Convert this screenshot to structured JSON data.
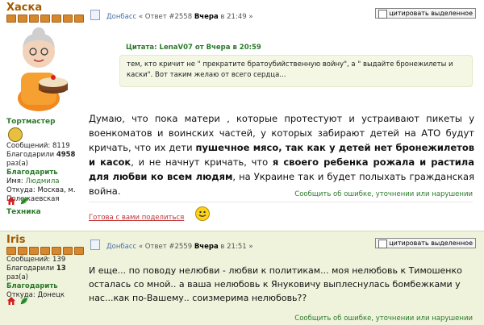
{
  "post1": {
    "user": {
      "name": "Хаска",
      "rank": "Тортмастер",
      "stats": {
        "messages_label": "Сообщений:",
        "messages": "8119",
        "thanked_label": "Благодарили",
        "thanked": "4958",
        "thanked_suffix": "раз(а)"
      },
      "thank_link": "Благодарить",
      "name_label": "Имя:",
      "real_name": "Людмила",
      "from_label": "Откуда:",
      "location": "Москва, м. Полежаевская",
      "section": "Техника"
    },
    "header": {
      "forum": "Донбасс",
      "reply_prefix": "« Ответ #2558",
      "date": "Вчера",
      "time_prefix": "в 21:49 »"
    },
    "quote_button": "цитировать выделенное",
    "quote": {
      "title": "Цитата: LenaV07 от Вчера в 20:59",
      "text": "тем, кто кричит не \" прекратите братоубийственную войну\", а \" выдайте бронежилеты и каски\". Вот таким желаю от всего сердца..."
    },
    "body": {
      "p1": "Думаю, что пока матери , которые протестуют и устраивают пикеты у военкоматов и воинских частей, у которых забирают детей на АТО будут кричать, что их дети ",
      "b1": "пушечное мясо, так как у детей нет бронежилетов и касок",
      "p2": ", и не начнут кричать, что ",
      "b2": "я своего ребенка рожала и растила для любви ко всем людям",
      "p3": ", на Украине так и будет полыхать гражданская война."
    },
    "report": "Сообщить об ошибке, уточнении или нарушении",
    "share": "Готова с вами поделиться"
  },
  "post2": {
    "user": {
      "name": "Iris",
      "stats": {
        "messages_label": "Сообщений:",
        "messages": "139",
        "thanked_label": "Благодарили",
        "thanked": "13",
        "thanked_suffix": "раз(а)"
      },
      "thank_link": "Благодарить",
      "from_label": "Откуда:",
      "location": "Донецк"
    },
    "header": {
      "forum": "Донбасс",
      "reply_prefix": "« Ответ #2559",
      "date": "Вчера",
      "time_prefix": "в 21:51 »"
    },
    "quote_button": "цитировать выделенное",
    "body": "И еще... по поводу нелюбви - любви к политикам... моя нелюбовь к Тимошенко осталась со мной.. а ваша нелюбовь к Януковичу выплеснулась бомбежками у нас...как по-Вашему.. соизмерима нелюбовь??",
    "report": "Сообщить об ошибке, уточнении или нарушении"
  },
  "colors": {
    "username": "#a05a00",
    "link_green": "#2a7a2a",
    "forum_blue": "#4a6fa5",
    "post2_bg": "#f0f3dc",
    "quote_bg": "#f4f7e4"
  }
}
